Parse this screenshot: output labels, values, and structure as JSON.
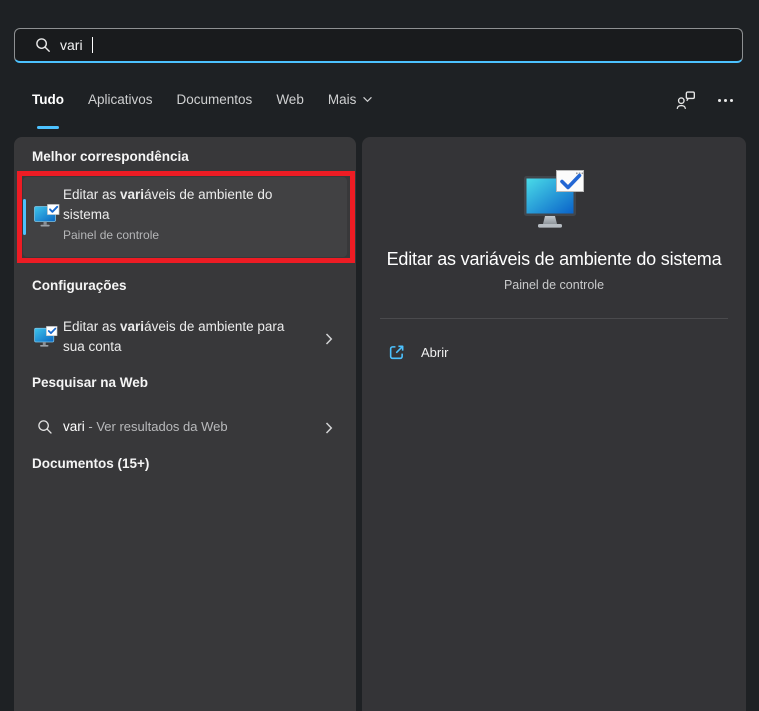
{
  "colors": {
    "accent": "#4cc2ff",
    "annotation_red": "#ed1c24",
    "panel_bg": "#38383a",
    "icon_screen_gradient": [
      "#49dbe8",
      "#0a62c9"
    ]
  },
  "search_bar": {
    "value": "vari",
    "icon": "search-icon"
  },
  "tabs": [
    {
      "label": "Tudo",
      "selected": true
    },
    {
      "label": "Aplicativos",
      "selected": false
    },
    {
      "label": "Documentos",
      "selected": false
    },
    {
      "label": "Web",
      "selected": false
    },
    {
      "label": "Mais",
      "selected": false,
      "has_dropdown": true
    }
  ],
  "left_panel": {
    "best_match": {
      "header": "Melhor correspondência",
      "item": {
        "title_pre": "Editar as ",
        "title_bold": "vari",
        "title_post": "áveis de ambiente do sistema",
        "subtitle": "Painel de controle"
      }
    },
    "settings": {
      "header": "Configurações",
      "item": {
        "title_pre": "Editar as ",
        "title_bold": "vari",
        "title_post": "áveis de ambiente para sua conta"
      }
    },
    "web_search": {
      "header": "Pesquisar na Web",
      "item": {
        "query": "vari",
        "suffix": " - Ver resultados da Web"
      }
    },
    "documents": {
      "header": "Documentos (15+)"
    }
  },
  "right_panel": {
    "title": "Editar as variáveis de ambiente do sistema",
    "subtitle": "Painel de controle",
    "actions": {
      "open": "Abrir"
    }
  }
}
